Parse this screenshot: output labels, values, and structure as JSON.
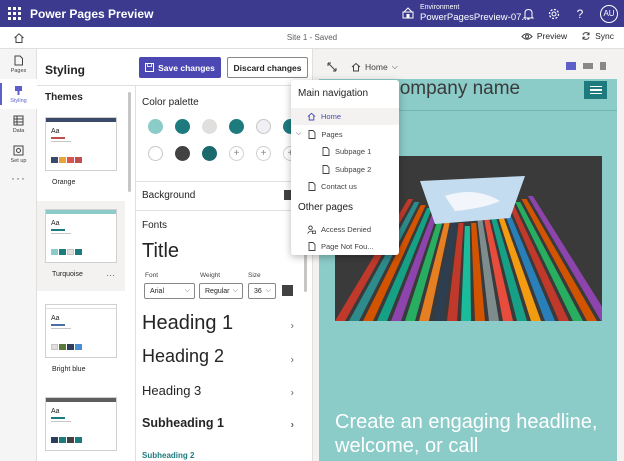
{
  "app": {
    "title": "Power Pages Preview",
    "environment_label": "Environment",
    "environment_name": "PowerPagesPreview-07...",
    "user_initials": "AU"
  },
  "cmdbar": {
    "site_status": "Site 1 - Saved",
    "preview_label": "Preview",
    "sync_label": "Sync"
  },
  "rail": {
    "items": [
      {
        "label": "Pages",
        "icon": "page-icon"
      },
      {
        "label": "Styling",
        "icon": "paintbrush-icon",
        "active": true
      },
      {
        "label": "Data",
        "icon": "table-icon"
      },
      {
        "label": "Set up",
        "icon": "setup-icon"
      }
    ],
    "more": "···"
  },
  "styling": {
    "title": "Styling",
    "save_label": "Save changes",
    "discard_label": "Discard changes"
  },
  "themes": {
    "heading": "Themes",
    "items": [
      {
        "name": "Orange",
        "bar": "#3b4a6b",
        "accent": "#c0504d",
        "swatches": [
          "#3b4a6b",
          "#e8a33d",
          "#d9534f",
          "#c0504d"
        ]
      },
      {
        "name": "Turquoise",
        "bar": "#8bcbc8",
        "accent": "#1d7b7e",
        "swatches": [
          "#8bcbc8",
          "#1d7b7e",
          "#e1dfdd",
          "#1d7b7e"
        ],
        "selected": true
      },
      {
        "name": "Bright blue",
        "bar": "#ffffff",
        "accent": "#4a6fa5",
        "swatches": [
          "#e1dfdd",
          "#5b7a3a",
          "#2d3e5a",
          "#4a8fd4"
        ]
      },
      {
        "name": "",
        "bar": "#605e5c",
        "accent": "#1d7b7e",
        "swatches": [
          "#2d3e5a",
          "#1d7b7e",
          "#424242",
          "#1d7b7e"
        ]
      }
    ]
  },
  "palette": {
    "heading": "Color palette",
    "colors": [
      "#8bcbc8",
      "#1d7b7e",
      "#e1dfdd",
      "#1d7b7e",
      "#eef0f4",
      "#1d7b7e",
      "#ffffff",
      "#424242",
      "#1a6a6d"
    ]
  },
  "background": {
    "heading": "Background",
    "color": "#424242"
  },
  "fonts": {
    "heading": "Fonts",
    "title_sample": "Title",
    "font_label": "Font",
    "font_value": "Arial",
    "weight_label": "Weight",
    "weight_value": "Regular",
    "size_label": "Size",
    "size_value": "36",
    "headings": [
      "Heading 1",
      "Heading 2",
      "Heading 3",
      "Subheading 1",
      "Subheading 2"
    ]
  },
  "preview": {
    "nav_label": "Home",
    "site_name": "Company name",
    "hero_text": "Create an engaging headline, welcome, or call"
  },
  "navmenu": {
    "main_heading": "Main navigation",
    "items": [
      {
        "label": "Home",
        "icon": "home-icon",
        "active": true,
        "indent": 0
      },
      {
        "label": "Pages",
        "icon": "page-icon",
        "indent": 0,
        "expand": true
      },
      {
        "label": "Subpage 1",
        "icon": "page-icon",
        "indent": 1
      },
      {
        "label": "Subpage 2",
        "icon": "page-icon",
        "indent": 1
      },
      {
        "label": "Contact us",
        "icon": "page-icon",
        "indent": 0
      }
    ],
    "other_heading": "Other pages",
    "other_items": [
      {
        "label": "Access Denied",
        "icon": "person-lock-icon"
      },
      {
        "label": "Page Not Fou...",
        "icon": "page-icon"
      }
    ]
  },
  "colors": {
    "brand": "#3b3a8f",
    "accent": "#4b47b3",
    "site_bg": "#8bcbc8",
    "site_primary": "#1d7b7e"
  }
}
